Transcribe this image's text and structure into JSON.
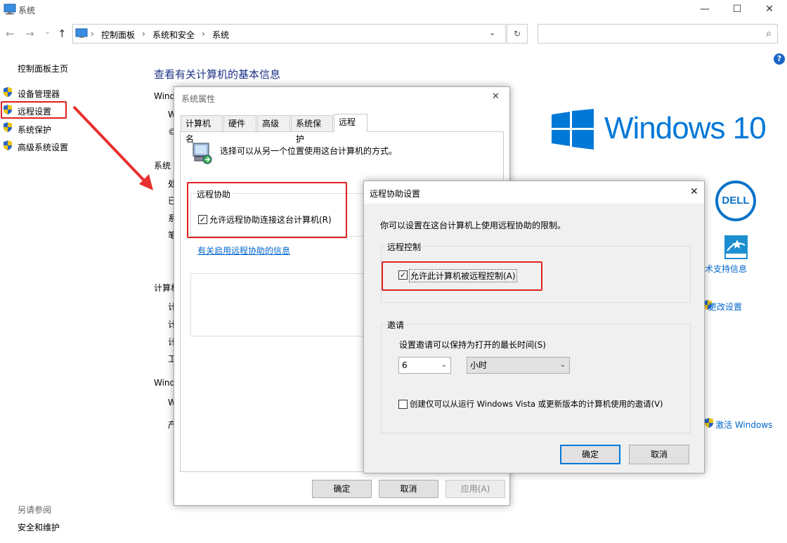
{
  "window": {
    "title": "系统",
    "minimize": "—",
    "maximize": "☐",
    "close": "✕"
  },
  "nav": {
    "back": "←",
    "forward": "→",
    "dropdown": "⌄",
    "up": "↑",
    "breadcrumb": [
      "控制面板",
      "系统和安全",
      "系统"
    ],
    "sep": "›",
    "refresh": "↻",
    "search_placeholder": ""
  },
  "left_panel": {
    "home": "控制面板主页",
    "items": [
      "设备管理器",
      "远程设置",
      "系统保护",
      "高级系统设置"
    ],
    "see_also_title": "另请参阅",
    "see_also_items": [
      "安全和维护"
    ]
  },
  "main": {
    "title": "查看有关计算机的基本信息",
    "section_labels": [
      "Wind",
      "W",
      "©",
      "系统",
      "处",
      "已",
      "系",
      "笔",
      "计算机",
      "计",
      "计",
      "计",
      "工",
      "Wind",
      "W",
      "产"
    ],
    "windows_brand": "Windows 10",
    "dell_logo": "DELL",
    "support_link": "术支持信息",
    "change_settings": "更改设置",
    "activate_windows": "激活 Windows",
    "help": "?"
  },
  "system_properties": {
    "title": "系统属性",
    "close": "✕",
    "tabs": [
      "计算机名",
      "硬件",
      "高级",
      "系统保护",
      "远程"
    ],
    "active_tab": "远程",
    "intro": "选择可以从另一个位置使用这台计算机的方式。",
    "group_title": "远程协助",
    "allow_label": "允许远程协助连接这台计算机(R)",
    "allow_checked": true,
    "info_link": "有关启用远程协助的信息",
    "buttons": {
      "ok": "确定",
      "cancel": "取消",
      "apply": "应用(A)"
    }
  },
  "remote_assist_settings": {
    "title": "远程协助设置",
    "close": "✕",
    "intro": "你可以设置在这台计算机上使用远程协助的限制。",
    "remote_control_title": "远程控制",
    "allow_control_label": "允许此计算机被远程控制(A)",
    "allow_control_checked": true,
    "invitation_title": "邀请",
    "invite_time_label": "设置邀请可以保持为打开的最长时间(S)",
    "time_value": "6",
    "time_unit": "小时",
    "vista_label": "创建仅可以从运行 Windows Vista 或更新版本的计算机使用的邀请(V)",
    "vista_checked": false,
    "buttons": {
      "ok": "确定",
      "cancel": "取消"
    }
  },
  "colors": {
    "accent_blue": "#0066cc",
    "windows_blue": "#0078d7",
    "highlight_red": "#e02020"
  }
}
